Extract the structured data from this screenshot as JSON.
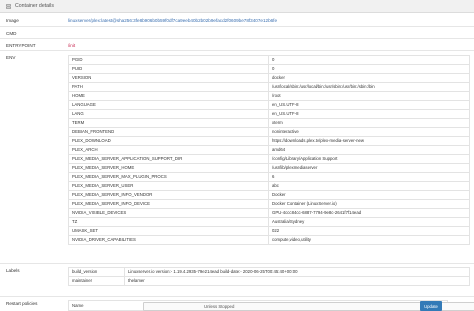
{
  "header": {
    "title": "Container details",
    "icon": "server-icon"
  },
  "image": {
    "label": "Image",
    "value": "linuxserver/plex:latest@sha256:3fe8b906b0b59f0df7ca9eeb40b2b02b9efacd2f0609be78f3407e12b6fe"
  },
  "cmd": {
    "label": "CMD"
  },
  "entrypoint": {
    "label": "ENTRYPOINT",
    "value": "/init"
  },
  "env": {
    "label": "ENV",
    "rows": [
      [
        "PGID",
        "0"
      ],
      [
        "PUID",
        "0"
      ],
      [
        "VERSION",
        "docker"
      ],
      [
        "PATH",
        "/usr/local/sbin:/usr/local/bin:/usr/sbin:/usr/bin:/sbin:/bin"
      ],
      [
        "HOME",
        "/root"
      ],
      [
        "LANGUAGE",
        "en_US.UTF-8"
      ],
      [
        "LANG",
        "en_US.UTF-8"
      ],
      [
        "TERM",
        "xterm"
      ],
      [
        "DEBIAN_FRONTEND",
        "noninteractive"
      ],
      [
        "PLEX_DOWNLOAD",
        "https://downloads.plex.tv/plex-media-server-new"
      ],
      [
        "PLEX_ARCH",
        "amd64"
      ],
      [
        "PLEX_MEDIA_SERVER_APPLICATION_SUPPORT_DIR",
        "/config/Library/Application Support"
      ],
      [
        "PLEX_MEDIA_SERVER_HOME",
        "/usr/lib/plexmediaserver"
      ],
      [
        "PLEX_MEDIA_SERVER_MAX_PLUGIN_PROCS",
        "6"
      ],
      [
        "PLEX_MEDIA_SERVER_USER",
        "abc"
      ],
      [
        "PLEX_MEDIA_SERVER_INFO_VENDOR",
        "Docker"
      ],
      [
        "PLEX_MEDIA_SERVER_INFO_DEVICE",
        "Docker Container (LinuxServer.io)"
      ],
      [
        "NVIDIA_VISIBLE_DEVICES",
        "GPU-4ccc84cc-6887-7794-9e8c-2641f7f14ead"
      ],
      [
        "TZ",
        "Australia/Sydney"
      ],
      [
        "UMASK_SET",
        "022"
      ],
      [
        "NVIDIA_DRIVER_CAPABILITIES",
        "compute,video,utility"
      ]
    ]
  },
  "labels": {
    "label": "Labels",
    "rows": [
      [
        "build_version",
        "Linuxserver.io version:- 1.19.4.2935-79e214ead build-date:- 2020-06-25T00:45:40+00:00"
      ],
      [
        "maintainer",
        "thelamer"
      ]
    ]
  },
  "restart": {
    "label": "Restart policies",
    "name_label": "Name",
    "selected": "Unless Stopped",
    "update_label": "Update"
  }
}
